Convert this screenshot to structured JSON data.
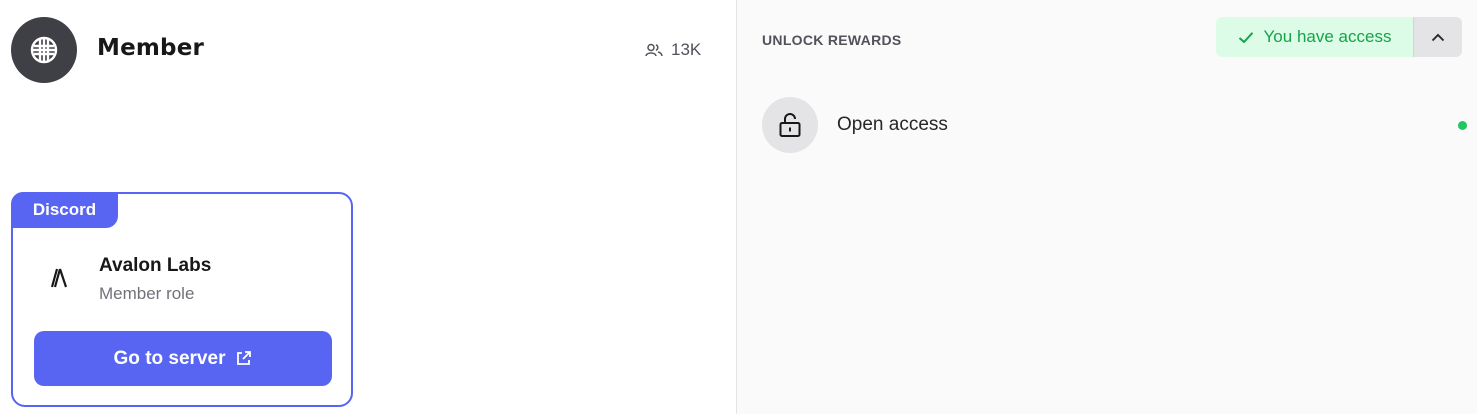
{
  "role": {
    "title": "Member",
    "member_count": "13K",
    "icon": "globe-grid-icon"
  },
  "reward": {
    "platform_tag": "Discord",
    "server_name": "Avalon Labs",
    "server_role": "Member role",
    "button_label": "Go to server",
    "button_icon": "external-link-icon",
    "accent_color": "#5865f2"
  },
  "unlock": {
    "heading": "UNLOCK REWARDS",
    "access_label": "You have access",
    "access_color": "#16a34a",
    "toggle_icon": "chevron-up-icon",
    "requirements": [
      {
        "label": "Open access",
        "icon": "unlocked-padlock-icon",
        "status_color": "#22c55e"
      }
    ]
  }
}
